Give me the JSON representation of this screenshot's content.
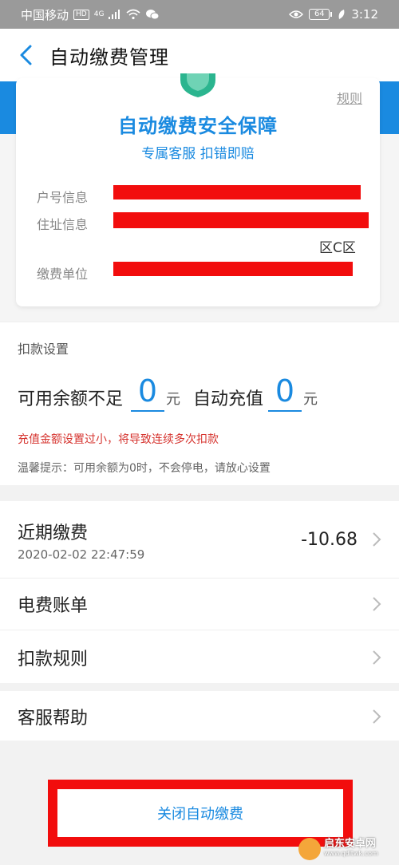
{
  "status_bar": {
    "carrier": "中国移动",
    "hd": "HD",
    "network": "4G",
    "battery": "64",
    "time": "3:12"
  },
  "header": {
    "title": "自动缴费管理"
  },
  "guarantee_card": {
    "rule_link": "规则",
    "title": "自动缴费安全保障",
    "subtitle": "专属客服 扣错即赔",
    "account_label": "户号信息",
    "address_label": "住址信息",
    "address_tail": "区C区",
    "unit_label": "缴费单位"
  },
  "deduction_settings": {
    "section_label": "扣款设置",
    "low_balance_label": "可用余额不足",
    "low_balance_value": "0",
    "unit": "元",
    "auto_recharge_label": "自动充值",
    "auto_recharge_value": "0",
    "warning": "充值金额设置过小，将导致连续多次扣款",
    "tip": "温馨提示：可用余额为0时，不会停电，请放心设置"
  },
  "list": {
    "recent_payment": {
      "title": "近期缴费",
      "datetime": "2020-02-02 22:47:59",
      "amount": "-10.68"
    },
    "electric_bill": "电费账单",
    "deduction_rules": "扣款规则",
    "customer_help": "客服帮助"
  },
  "bottom_button": {
    "label": "关闭自动缴费"
  },
  "watermark": {
    "title": "启东安卓网",
    "url": "www.qdltwk.com"
  },
  "colors": {
    "accent": "#1a8ae0",
    "warning": "#d6342f",
    "redaction": "#f20d0d"
  }
}
